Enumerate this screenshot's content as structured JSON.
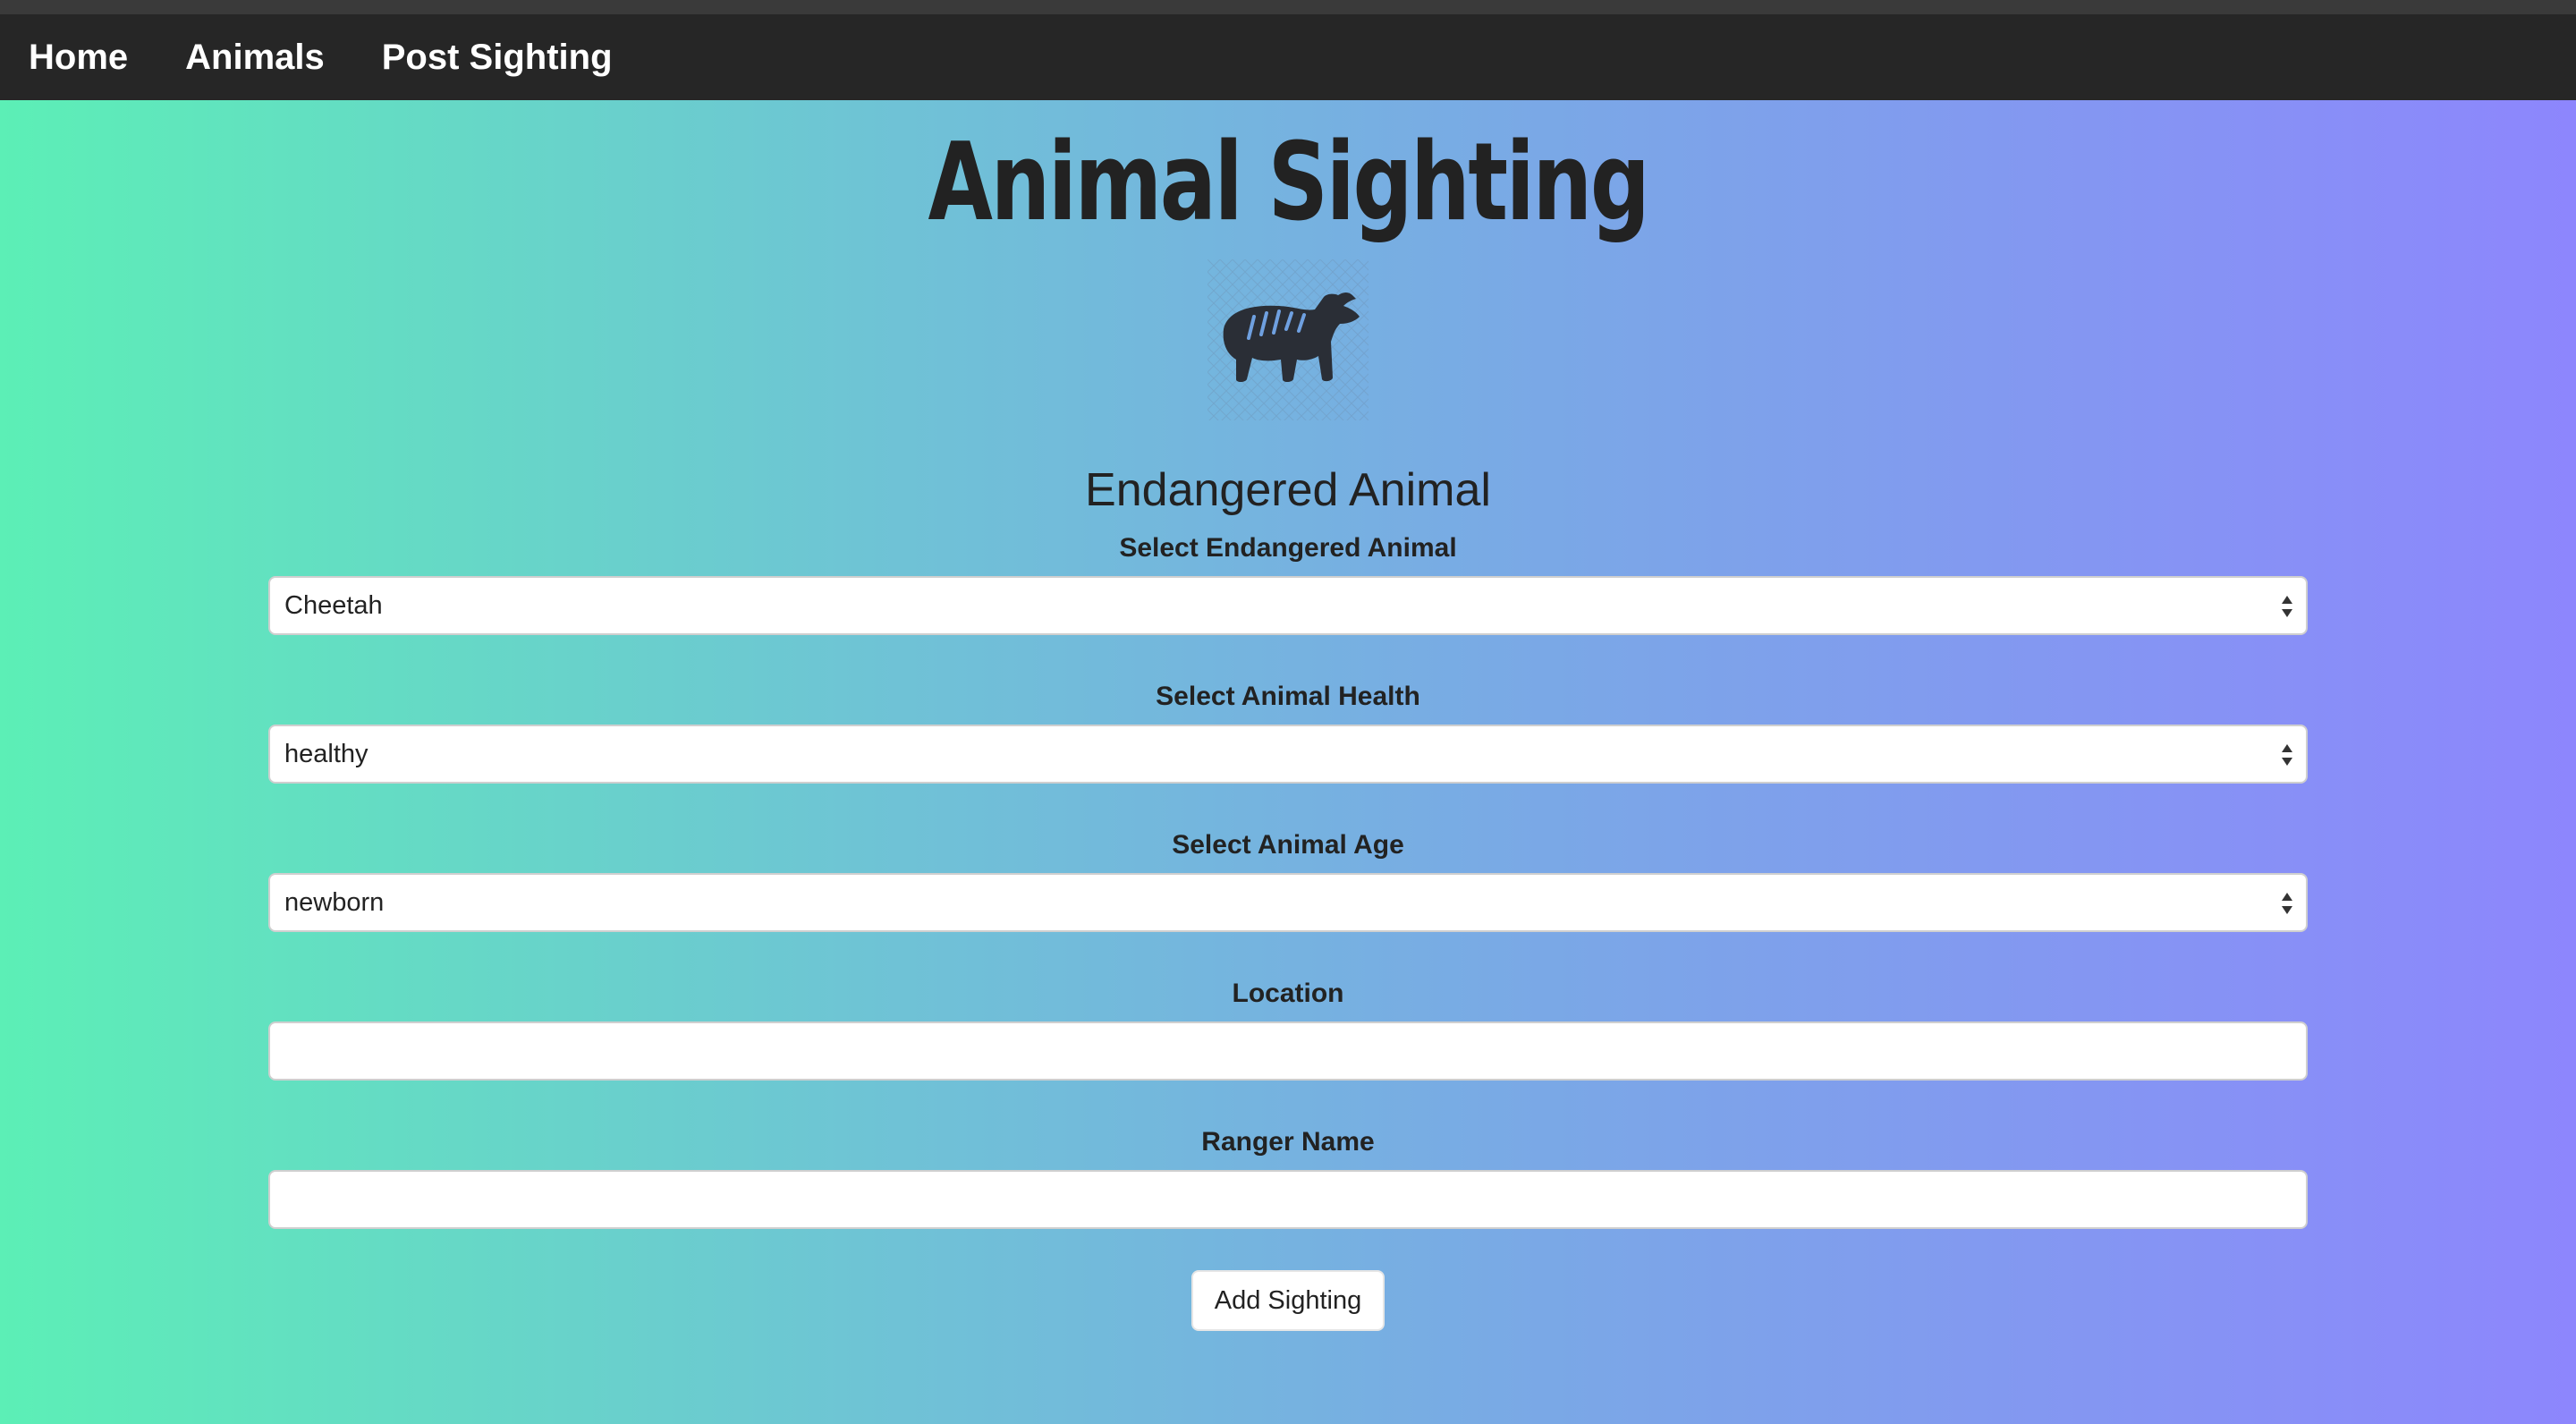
{
  "nav": {
    "items": [
      {
        "label": "Home"
      },
      {
        "label": "Animals"
      },
      {
        "label": "Post Sighting"
      }
    ]
  },
  "header": {
    "title": "Animal Sighting",
    "logo_icon": "hippo-icon"
  },
  "form": {
    "heading": "Endangered Animal",
    "animal_label": "Select Endangered Animal",
    "animal_value": "Cheetah",
    "health_label": "Select Animal Health",
    "health_value": "healthy",
    "age_label": "Select Animal Age",
    "age_value": "newborn",
    "location_label": "Location",
    "location_value": "",
    "ranger_label": "Ranger Name",
    "ranger_value": "",
    "submit_label": "Add Sighting"
  },
  "colors": {
    "gradient_left": "#5cefb6",
    "gradient_right": "#8d86fd",
    "navbar": "#262626",
    "text": "#222222"
  }
}
